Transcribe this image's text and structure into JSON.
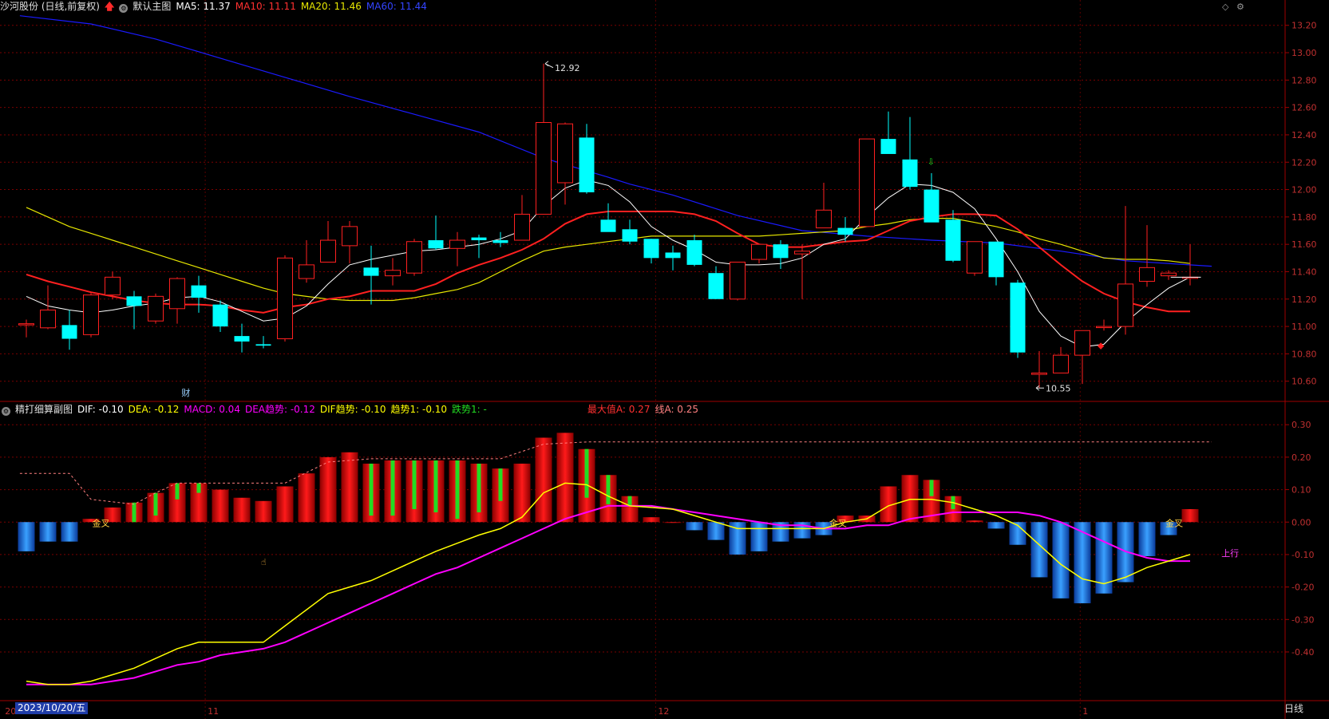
{
  "main_header": {
    "name": "沙河股份 (日线,前复权)",
    "template": "默认主图",
    "ma5": "MA5: 11.37",
    "ma10": "MA10: 11.11",
    "ma20": "MA20: 11.46",
    "ma60": "MA60: 11.44"
  },
  "sub_header": {
    "name": "精打细算副图",
    "dif": "DIF: -0.10",
    "dea": "DEA: -0.12",
    "macd": "MACD: 0.04",
    "dea_trend": "DEA趋势: -0.12",
    "dif_trend": "DIF趋势: -0.10",
    "trend1": "趋势1: -0.10",
    "fall1": "跌势1: -",
    "maxA": "最大值A: 0.27",
    "lineA": "线A: 0.25"
  },
  "colors": {
    "up": "#ff2020",
    "down": "#00ffff",
    "ma5": "#ffffff",
    "ma10": "#ff2020",
    "ma20": "#e6e600",
    "ma60": "#1a1aff",
    "dif": "#ffff00",
    "dea": "#ff00ff",
    "grid": "#7a0000"
  },
  "bottom_bar": {
    "date": "2023/10/20/五",
    "month_labels": [
      "20",
      "11",
      "12",
      "1"
    ],
    "period": "日线"
  },
  "chart_data": [
    {
      "type": "candlestick",
      "ylim": [
        10.47,
        13.28
      ],
      "yticks": [
        "13.20",
        "13.00",
        "12.80",
        "12.60",
        "12.40",
        "12.20",
        "12.00",
        "11.80",
        "11.60",
        "11.40",
        "11.20",
        "11.00",
        "10.80",
        "10.60"
      ],
      "annotations": {
        "high_label": "12.92",
        "low_label": "10.55",
        "fin_marker": "财",
        "down_arrow": "⇩",
        "up_diamond": "◆"
      },
      "ohlc": [
        [
          11.02,
          11.05,
          10.92,
          11.02
        ],
        [
          10.99,
          11.3,
          10.98,
          11.12
        ],
        [
          11.01,
          11.12,
          10.83,
          10.91
        ],
        [
          10.94,
          11.25,
          10.92,
          11.23
        ],
        [
          11.23,
          11.4,
          11.2,
          11.36
        ],
        [
          11.22,
          11.26,
          10.98,
          11.15
        ],
        [
          11.04,
          11.24,
          11.02,
          11.22
        ],
        [
          11.13,
          11.36,
          11.02,
          11.35
        ],
        [
          11.3,
          11.37,
          11.1,
          11.21
        ],
        [
          11.16,
          11.19,
          10.96,
          11.0
        ],
        [
          10.93,
          11.02,
          10.81,
          10.89
        ],
        [
          10.87,
          10.93,
          10.84,
          10.86
        ],
        [
          10.91,
          11.52,
          10.89,
          11.5
        ],
        [
          11.35,
          11.63,
          11.32,
          11.45
        ],
        [
          11.47,
          11.77,
          11.47,
          11.63
        ],
        [
          11.59,
          11.77,
          11.46,
          11.73
        ],
        [
          11.43,
          11.59,
          11.16,
          11.37
        ],
        [
          11.37,
          11.5,
          11.3,
          11.41
        ],
        [
          11.39,
          11.64,
          11.37,
          11.62
        ],
        [
          11.63,
          11.81,
          11.56,
          11.57
        ],
        [
          11.57,
          11.69,
          11.44,
          11.63
        ],
        [
          11.65,
          11.67,
          11.5,
          11.63
        ],
        [
          11.63,
          11.69,
          11.58,
          11.61
        ],
        [
          11.63,
          11.96,
          11.63,
          11.82
        ],
        [
          11.82,
          12.92,
          11.82,
          12.49
        ],
        [
          12.05,
          12.49,
          11.89,
          12.48
        ],
        [
          12.38,
          12.48,
          11.97,
          11.98
        ],
        [
          11.78,
          11.9,
          11.7,
          11.69
        ],
        [
          11.71,
          11.78,
          11.6,
          11.62
        ],
        [
          11.64,
          11.64,
          11.46,
          11.5
        ],
        [
          11.54,
          11.59,
          11.41,
          11.5
        ],
        [
          11.63,
          11.67,
          11.44,
          11.45
        ],
        [
          11.39,
          11.44,
          11.2,
          11.2
        ],
        [
          11.2,
          11.4,
          11.19,
          11.47
        ],
        [
          11.49,
          11.6,
          11.46,
          11.6
        ],
        [
          11.6,
          11.63,
          11.42,
          11.5
        ],
        [
          11.53,
          11.6,
          11.2,
          11.55
        ],
        [
          11.72,
          12.05,
          11.72,
          11.85
        ],
        [
          11.72,
          11.8,
          11.62,
          11.67
        ],
        [
          11.73,
          12.35,
          11.73,
          12.37
        ],
        [
          12.37,
          12.57,
          12.27,
          12.26
        ],
        [
          12.22,
          12.53,
          12.0,
          12.02
        ],
        [
          12.0,
          12.12,
          11.8,
          11.76
        ],
        [
          11.78,
          11.85,
          11.47,
          11.48
        ],
        [
          11.39,
          11.62,
          11.37,
          11.62
        ],
        [
          11.62,
          11.62,
          11.3,
          11.36
        ],
        [
          11.32,
          11.34,
          10.77,
          10.81
        ],
        [
          10.65,
          10.82,
          10.55,
          10.66
        ],
        [
          10.66,
          10.85,
          10.66,
          10.79
        ],
        [
          10.79,
          10.97,
          10.58,
          10.97
        ],
        [
          11.0,
          11.05,
          10.97,
          11.0
        ],
        [
          11.0,
          11.88,
          10.94,
          11.31
        ],
        [
          11.33,
          11.74,
          11.29,
          11.43
        ],
        [
          11.37,
          11.41,
          11.34,
          11.39
        ],
        [
          11.36,
          11.6,
          11.3,
          11.36
        ]
      ],
      "ma5": [
        11.22,
        11.15,
        11.12,
        11.1,
        11.12,
        11.15,
        11.17,
        11.21,
        11.22,
        11.18,
        11.11,
        11.04,
        11.06,
        11.15,
        11.31,
        11.45,
        11.49,
        11.52,
        11.55,
        11.56,
        11.58,
        11.6,
        11.64,
        11.7,
        11.88,
        12.01,
        12.07,
        12.03,
        11.91,
        11.73,
        11.63,
        11.56,
        11.47,
        11.45,
        11.45,
        11.46,
        11.5,
        11.6,
        11.64,
        11.8,
        11.94,
        12.04,
        12.03,
        11.98,
        11.86,
        11.64,
        11.4,
        11.11,
        10.93,
        10.85,
        10.87,
        11.03,
        11.16,
        11.28,
        11.36
      ],
      "ma10": [
        11.38,
        11.33,
        11.29,
        11.25,
        11.22,
        11.19,
        11.17,
        11.16,
        11.16,
        11.15,
        11.12,
        11.1,
        11.14,
        11.16,
        11.2,
        11.22,
        11.26,
        11.26,
        11.26,
        11.31,
        11.39,
        11.45,
        11.5,
        11.56,
        11.64,
        11.75,
        11.82,
        11.84,
        11.84,
        11.84,
        11.84,
        11.82,
        11.77,
        11.68,
        11.6,
        11.58,
        11.58,
        11.6,
        11.62,
        11.63,
        11.7,
        11.77,
        11.8,
        11.82,
        11.82,
        11.81,
        11.71,
        11.58,
        11.45,
        11.33,
        11.24,
        11.18,
        11.14,
        11.11,
        11.11
      ],
      "ma20": [
        11.87,
        11.8,
        11.73,
        11.68,
        11.63,
        11.58,
        11.53,
        11.48,
        11.43,
        11.38,
        11.33,
        11.28,
        11.24,
        11.22,
        11.2,
        11.19,
        11.19,
        11.19,
        11.21,
        11.24,
        11.27,
        11.32,
        11.4,
        11.48,
        11.55,
        11.58,
        11.6,
        11.62,
        11.64,
        11.66,
        11.66,
        11.66,
        11.66,
        11.66,
        11.66,
        11.67,
        11.68,
        11.69,
        11.7,
        11.73,
        11.75,
        11.78,
        11.79,
        11.79,
        11.76,
        11.73,
        11.69,
        11.64,
        11.6,
        11.55,
        11.5,
        11.49,
        11.49,
        11.48,
        11.46
      ],
      "ma60_points": [
        [
          -0.3,
          13.27
        ],
        [
          3,
          13.21
        ],
        [
          6,
          13.1
        ],
        [
          9,
          12.96
        ],
        [
          12,
          12.82
        ],
        [
          15,
          12.68
        ],
        [
          18,
          12.55
        ],
        [
          21,
          12.42
        ],
        [
          24,
          12.23
        ],
        [
          27,
          12.09
        ],
        [
          28,
          12.04
        ],
        [
          30,
          11.96
        ],
        [
          33,
          11.81
        ],
        [
          36,
          11.7
        ],
        [
          39,
          11.66
        ],
        [
          42,
          11.63
        ],
        [
          45,
          11.61
        ],
        [
          48,
          11.55
        ],
        [
          51,
          11.48
        ],
        [
          55,
          11.44
        ]
      ]
    },
    {
      "type": "macd",
      "ylim": [
        -0.55,
        0.33
      ],
      "yticks": [
        "0.30",
        "0.20",
        "0.10",
        "0.00",
        "-0.10",
        "-0.20",
        "-0.30",
        "-0.40"
      ],
      "macd": [
        -0.09,
        -0.06,
        -0.06,
        0.01,
        0.045,
        0.06,
        0.09,
        0.12,
        0.12,
        0.1,
        0.075,
        0.065,
        0.11,
        0.15,
        0.2,
        0.215,
        0.18,
        0.19,
        0.19,
        0.19,
        0.19,
        0.18,
        0.165,
        0.18,
        0.26,
        0.275,
        0.225,
        0.145,
        0.08,
        0.015,
        0.0,
        -0.025,
        -0.055,
        -0.1,
        -0.09,
        -0.06,
        -0.05,
        -0.04,
        0.02,
        0.02,
        0.11,
        0.145,
        0.13,
        0.08,
        0.005,
        -0.02,
        -0.07,
        -0.17,
        -0.235,
        -0.25,
        -0.22,
        -0.185,
        -0.105,
        -0.04,
        0.04
      ],
      "macd_inner": [
        0,
        0,
        0,
        0,
        0,
        0.06,
        0.07,
        0.05,
        0.03,
        0,
        0,
        0,
        0,
        0,
        0,
        0,
        0.16,
        0.17,
        0.15,
        0.16,
        0.18,
        0.15,
        0.1,
        0,
        0,
        0,
        0.15,
        0.09,
        0.03,
        0,
        0,
        0,
        0,
        0,
        0,
        0,
        0,
        0,
        0,
        0,
        0,
        0,
        0.05,
        0.04,
        0,
        0,
        0,
        0,
        0,
        0,
        0,
        0,
        0,
        0,
        0
      ],
      "dif": [
        -0.49,
        -0.5,
        -0.5,
        -0.49,
        -0.47,
        -0.45,
        -0.42,
        -0.39,
        -0.37,
        -0.37,
        -0.37,
        -0.37,
        -0.32,
        -0.27,
        -0.22,
        -0.2,
        -0.18,
        -0.15,
        -0.12,
        -0.09,
        -0.065,
        -0.04,
        -0.02,
        0.015,
        0.09,
        0.12,
        0.115,
        0.08,
        0.05,
        0.045,
        0.04,
        0.02,
        0.0,
        -0.02,
        -0.02,
        -0.02,
        -0.02,
        -0.02,
        0.0,
        0.01,
        0.05,
        0.07,
        0.07,
        0.06,
        0.04,
        0.02,
        -0.01,
        -0.07,
        -0.13,
        -0.175,
        -0.19,
        -0.17,
        -0.14,
        -0.12,
        -0.1
      ],
      "dea": [
        -0.5,
        -0.5,
        -0.5,
        -0.5,
        -0.49,
        -0.48,
        -0.46,
        -0.44,
        -0.43,
        -0.41,
        -0.4,
        -0.39,
        -0.37,
        -0.34,
        -0.31,
        -0.28,
        -0.25,
        -0.22,
        -0.19,
        -0.16,
        -0.14,
        -0.11,
        -0.08,
        -0.05,
        -0.02,
        0.01,
        0.03,
        0.05,
        0.05,
        0.05,
        0.04,
        0.03,
        0.02,
        0.01,
        0.0,
        -0.01,
        -0.01,
        -0.02,
        -0.02,
        -0.01,
        -0.01,
        0.01,
        0.02,
        0.03,
        0.03,
        0.03,
        0.03,
        0.02,
        0.0,
        -0.03,
        -0.06,
        -0.09,
        -0.11,
        -0.12,
        -0.12
      ],
      "dashed_line_points": [
        [
          -0.3,
          0.15
        ],
        [
          2,
          0.15
        ],
        [
          3,
          0.07
        ],
        [
          5,
          0.055
        ],
        [
          6,
          0.09
        ],
        [
          7,
          0.12
        ],
        [
          12,
          0.12
        ],
        [
          14,
          0.185
        ],
        [
          16,
          0.195
        ],
        [
          22,
          0.195
        ],
        [
          24,
          0.24
        ],
        [
          26,
          0.247
        ],
        [
          55,
          0.247
        ]
      ],
      "cross_labels": [
        {
          "text": "金叉",
          "i": 3.5,
          "v": -0.005
        },
        {
          "text": "金叉",
          "i": 37.7,
          "v": -0.005
        },
        {
          "text": "金叉",
          "i": 53.3,
          "v": -0.005
        }
      ],
      "up_label": {
        "text": "上行",
        "i": 55.6,
        "v": -0.095
      }
    }
  ]
}
